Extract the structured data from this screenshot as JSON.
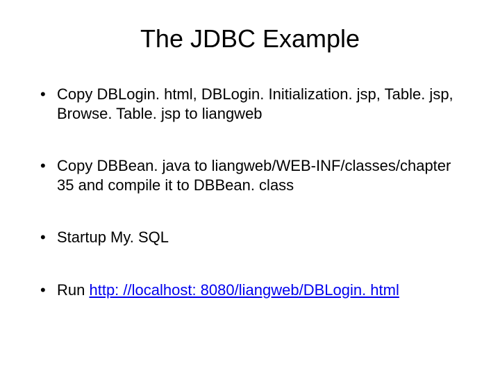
{
  "title": "The JDBC Example",
  "bullets": [
    {
      "text": "Copy DBLogin. html, DBLogin. Initialization. jsp, Table. jsp, Browse. Table. jsp to liangweb"
    },
    {
      "text": "Copy DBBean. java to liangweb/WEB-INF/classes/chapter 35 and compile it to DBBean. class"
    },
    {
      "text": "Startup My. SQL"
    },
    {
      "prefix": "Run ",
      "link": "http: //localhost: 8080/liangweb/DBLogin. html"
    }
  ]
}
